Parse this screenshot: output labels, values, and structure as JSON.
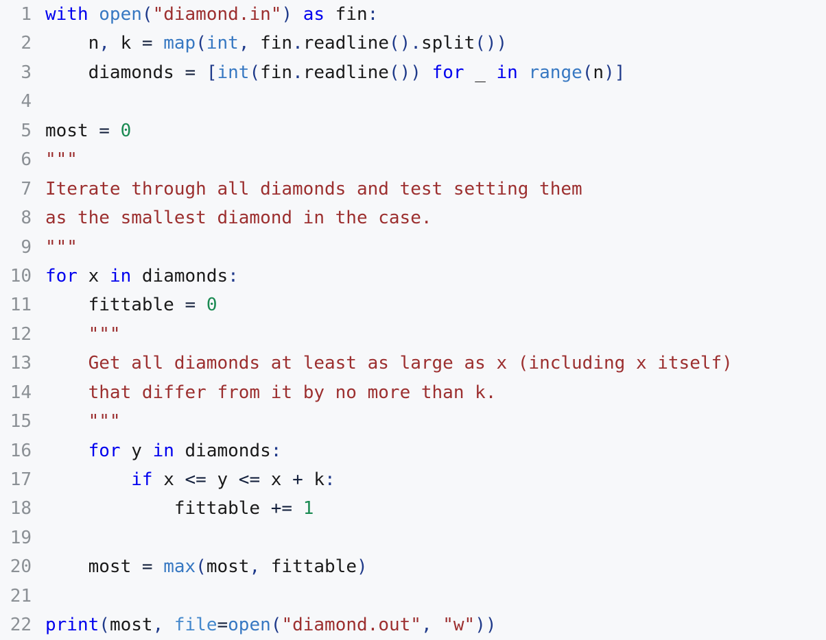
{
  "editor": {
    "language": "python",
    "background_color": "#f7f8fa",
    "line_number_color": "#8b9095",
    "total_lines": 22,
    "colors": {
      "keyword": "#0000ee",
      "builtin": "#3778c2",
      "keyword_argument": "#4488cc",
      "string": "#9c2f2f",
      "docstring": "#9c2f2f",
      "number": "#1a8a52",
      "punctuation": "#1f3a8a",
      "operator": "#14213d",
      "plain_text": "#1a1a1a"
    }
  },
  "code": {
    "lines": [
      {
        "number": "1",
        "text": "with open(\"diamond.in\") as fin:",
        "tokens": [
          {
            "t": "with",
            "c": "keyword"
          },
          {
            "t": " ",
            "c": "plain"
          },
          {
            "t": "open",
            "c": "builtin"
          },
          {
            "t": "(",
            "c": "punct"
          },
          {
            "t": "\"diamond.in\"",
            "c": "string"
          },
          {
            "t": ")",
            "c": "punct"
          },
          {
            "t": " ",
            "c": "plain"
          },
          {
            "t": "as",
            "c": "keyword"
          },
          {
            "t": " fin",
            "c": "plain"
          },
          {
            "t": ":",
            "c": "punct"
          }
        ]
      },
      {
        "number": "2",
        "text": "    n, k = map(int, fin.readline().split())",
        "tokens": [
          {
            "t": "    n",
            "c": "plain"
          },
          {
            "t": ",",
            "c": "punct"
          },
          {
            "t": " k ",
            "c": "plain"
          },
          {
            "t": "=",
            "c": "op"
          },
          {
            "t": " ",
            "c": "plain"
          },
          {
            "t": "map",
            "c": "builtin"
          },
          {
            "t": "(",
            "c": "punct"
          },
          {
            "t": "int",
            "c": "builtin"
          },
          {
            "t": ",",
            "c": "punct"
          },
          {
            "t": " fin",
            "c": "plain"
          },
          {
            "t": ".",
            "c": "punct"
          },
          {
            "t": "readline",
            "c": "plain"
          },
          {
            "t": "()",
            "c": "punct"
          },
          {
            "t": ".",
            "c": "punct"
          },
          {
            "t": "split",
            "c": "plain"
          },
          {
            "t": "())",
            "c": "punct"
          }
        ]
      },
      {
        "number": "3",
        "text": "    diamonds = [int(fin.readline()) for _ in range(n)]",
        "tokens": [
          {
            "t": "    diamonds ",
            "c": "plain"
          },
          {
            "t": "=",
            "c": "op"
          },
          {
            "t": " ",
            "c": "plain"
          },
          {
            "t": "[",
            "c": "punct"
          },
          {
            "t": "int",
            "c": "builtin"
          },
          {
            "t": "(",
            "c": "punct"
          },
          {
            "t": "fin",
            "c": "plain"
          },
          {
            "t": ".",
            "c": "punct"
          },
          {
            "t": "readline",
            "c": "plain"
          },
          {
            "t": "())",
            "c": "punct"
          },
          {
            "t": " ",
            "c": "plain"
          },
          {
            "t": "for",
            "c": "keyword"
          },
          {
            "t": " _ ",
            "c": "plain"
          },
          {
            "t": "in",
            "c": "keyword"
          },
          {
            "t": " ",
            "c": "plain"
          },
          {
            "t": "range",
            "c": "builtin"
          },
          {
            "t": "(",
            "c": "punct"
          },
          {
            "t": "n",
            "c": "plain"
          },
          {
            "t": ")]",
            "c": "punct"
          }
        ]
      },
      {
        "number": "4",
        "text": "",
        "tokens": []
      },
      {
        "number": "5",
        "text": "most = 0",
        "tokens": [
          {
            "t": "most ",
            "c": "plain"
          },
          {
            "t": "=",
            "c": "op"
          },
          {
            "t": " ",
            "c": "plain"
          },
          {
            "t": "0",
            "c": "number"
          }
        ]
      },
      {
        "number": "6",
        "text": "\"\"\"",
        "tokens": [
          {
            "t": "\"\"\"",
            "c": "doc"
          }
        ]
      },
      {
        "number": "7",
        "text": "Iterate through all diamonds and test setting them",
        "tokens": [
          {
            "t": "Iterate through all diamonds and test setting them",
            "c": "doc"
          }
        ]
      },
      {
        "number": "8",
        "text": "as the smallest diamond in the case.",
        "tokens": [
          {
            "t": "as the smallest diamond in the case.",
            "c": "doc"
          }
        ]
      },
      {
        "number": "9",
        "text": "\"\"\"",
        "tokens": [
          {
            "t": "\"\"\"",
            "c": "doc"
          }
        ]
      },
      {
        "number": "10",
        "text": "for x in diamonds:",
        "tokens": [
          {
            "t": "for",
            "c": "keyword"
          },
          {
            "t": " x ",
            "c": "plain"
          },
          {
            "t": "in",
            "c": "keyword"
          },
          {
            "t": " diamonds",
            "c": "plain"
          },
          {
            "t": ":",
            "c": "punct"
          }
        ]
      },
      {
        "number": "11",
        "text": "    fittable = 0",
        "tokens": [
          {
            "t": "    fittable ",
            "c": "plain"
          },
          {
            "t": "=",
            "c": "op"
          },
          {
            "t": " ",
            "c": "plain"
          },
          {
            "t": "0",
            "c": "number"
          }
        ]
      },
      {
        "number": "12",
        "text": "    \"\"\"",
        "tokens": [
          {
            "t": "    ",
            "c": "plain"
          },
          {
            "t": "\"\"\"",
            "c": "doc"
          }
        ]
      },
      {
        "number": "13",
        "text": "    Get all diamonds at least as large as x (including x itself)",
        "tokens": [
          {
            "t": "    ",
            "c": "plain"
          },
          {
            "t": "Get all diamonds at least as large as x (including x itself)",
            "c": "doc"
          }
        ]
      },
      {
        "number": "14",
        "text": "    that differ from it by no more than k.",
        "tokens": [
          {
            "t": "    ",
            "c": "plain"
          },
          {
            "t": "that differ from it by no more than k.",
            "c": "doc"
          }
        ]
      },
      {
        "number": "15",
        "text": "    \"\"\"",
        "tokens": [
          {
            "t": "    ",
            "c": "plain"
          },
          {
            "t": "\"\"\"",
            "c": "doc"
          }
        ]
      },
      {
        "number": "16",
        "text": "    for y in diamonds:",
        "tokens": [
          {
            "t": "    ",
            "c": "plain"
          },
          {
            "t": "for",
            "c": "keyword"
          },
          {
            "t": " y ",
            "c": "plain"
          },
          {
            "t": "in",
            "c": "keyword"
          },
          {
            "t": " diamonds",
            "c": "plain"
          },
          {
            "t": ":",
            "c": "punct"
          }
        ]
      },
      {
        "number": "17",
        "text": "        if x <= y <= x + k:",
        "tokens": [
          {
            "t": "        ",
            "c": "plain"
          },
          {
            "t": "if",
            "c": "keyword"
          },
          {
            "t": " x ",
            "c": "plain"
          },
          {
            "t": "<=",
            "c": "op"
          },
          {
            "t": " y ",
            "c": "plain"
          },
          {
            "t": "<=",
            "c": "op"
          },
          {
            "t": " x ",
            "c": "plain"
          },
          {
            "t": "+",
            "c": "op"
          },
          {
            "t": " k",
            "c": "plain"
          },
          {
            "t": ":",
            "c": "punct"
          }
        ]
      },
      {
        "number": "18",
        "text": "            fittable += 1",
        "tokens": [
          {
            "t": "            fittable ",
            "c": "plain"
          },
          {
            "t": "+=",
            "c": "op"
          },
          {
            "t": " ",
            "c": "plain"
          },
          {
            "t": "1",
            "c": "number"
          }
        ]
      },
      {
        "number": "19",
        "text": "",
        "tokens": []
      },
      {
        "number": "20",
        "text": "    most = max(most, fittable)",
        "tokens": [
          {
            "t": "    most ",
            "c": "plain"
          },
          {
            "t": "=",
            "c": "op"
          },
          {
            "t": " ",
            "c": "plain"
          },
          {
            "t": "max",
            "c": "builtin"
          },
          {
            "t": "(",
            "c": "punct"
          },
          {
            "t": "most",
            "c": "plain"
          },
          {
            "t": ",",
            "c": "punct"
          },
          {
            "t": " fittable",
            "c": "plain"
          },
          {
            "t": ")",
            "c": "punct"
          }
        ]
      },
      {
        "number": "21",
        "text": "",
        "tokens": []
      },
      {
        "number": "22",
        "text": "print(most, file=open(\"diamond.out\", \"w\"))",
        "tokens": [
          {
            "t": "print",
            "c": "keyword"
          },
          {
            "t": "(",
            "c": "punct"
          },
          {
            "t": "most",
            "c": "plain"
          },
          {
            "t": ",",
            "c": "punct"
          },
          {
            "t": " ",
            "c": "plain"
          },
          {
            "t": "file",
            "c": "kwarg"
          },
          {
            "t": "=",
            "c": "op"
          },
          {
            "t": "open",
            "c": "builtin"
          },
          {
            "t": "(",
            "c": "punct"
          },
          {
            "t": "\"diamond.out\"",
            "c": "string"
          },
          {
            "t": ",",
            "c": "punct"
          },
          {
            "t": " ",
            "c": "plain"
          },
          {
            "t": "\"w\"",
            "c": "string"
          },
          {
            "t": "))",
            "c": "punct"
          }
        ]
      }
    ]
  }
}
